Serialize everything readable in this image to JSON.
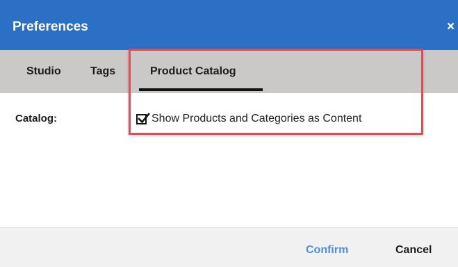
{
  "dialog": {
    "title": "Preferences",
    "close_glyph": "×",
    "close_icon": "close-icon"
  },
  "tabs": [
    {
      "label": "Studio",
      "active": false
    },
    {
      "label": "Tags",
      "active": false
    },
    {
      "label": "Product Catalog",
      "active": true
    }
  ],
  "content": {
    "field_label": "Catalog:",
    "checkbox": {
      "label": "Show Products and Categories as Content",
      "checked": true,
      "icon": "check-icon"
    }
  },
  "footer": {
    "confirm_label": "Confirm",
    "cancel_label": "Cancel"
  },
  "colors": {
    "titlebar": "#2b70c4",
    "tabbar": "#cbc9c8",
    "highlight": "#e04b55",
    "confirm": "#4f8fd6"
  }
}
